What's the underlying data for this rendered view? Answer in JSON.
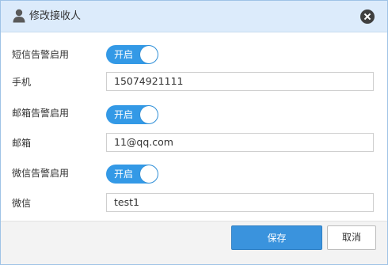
{
  "dialog": {
    "title": "修改接收人",
    "title_icon": "user-icon",
    "close_icon": "close-icon"
  },
  "form": {
    "sms_enable_label": "短信告警启用",
    "sms_toggle_text": "开启",
    "sms_toggle_on": true,
    "phone_label": "手机",
    "phone_value": "15074921111",
    "email_enable_label": "邮箱告警启用",
    "email_toggle_text": "开启",
    "email_toggle_on": true,
    "email_label": "邮箱",
    "email_value": "11@qq.com",
    "wechat_enable_label": "微信告警启用",
    "wechat_toggle_text": "开启",
    "wechat_toggle_on": true,
    "wechat_label": "微信",
    "wechat_value": "test1"
  },
  "footer": {
    "save_label": "保存",
    "cancel_label": "取消"
  },
  "colors": {
    "titlebar": "#dcebfb",
    "accent": "#3a93dd",
    "toggle_on": "#3399e6"
  }
}
